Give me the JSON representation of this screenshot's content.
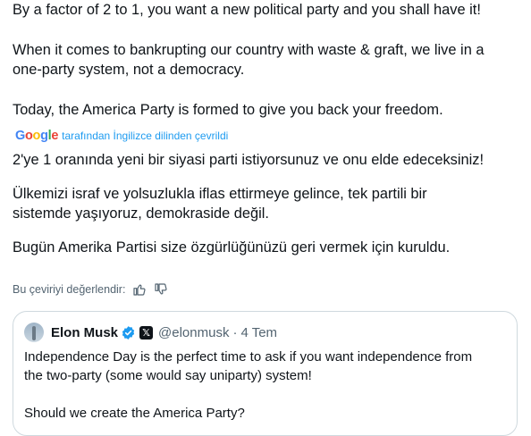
{
  "tweet": {
    "lines": [
      "By a factor of 2 to 1, you want a new political party and you shall have it!",
      "When it comes to bankrupting our country with waste & graft, we live in a",
      "one-party system, not a democracy.",
      "Today, the America Party is formed to give you back your freedom."
    ]
  },
  "translation": {
    "provider": "Google",
    "label": "tarafından İngilizce dilinden çevrildi",
    "lines": [
      "2'ye 1 oranında yeni bir siyasi parti istiyorsunuz ve onu elde edeceksiniz!",
      "Ülkemizi israf ve yolsuzlukla iflas ettirmeye gelince, tek partili bir",
      "sistemde yaşıyoruz, demokraside değil.",
      "Bugün Amerika Partisi size özgürlüğünüzü geri vermek için kuruldu."
    ],
    "rate_label": "Bu çeviriyi değerlendir:"
  },
  "quote": {
    "author_name": "Elon Musk",
    "handle": "@elonmusk",
    "separator": "·",
    "date": "4 Tem",
    "body": [
      "Independence Day is the perfect time to ask if you want independence from",
      "the two-party (some would say uniparty) system!",
      "Should we create the America Party?"
    ]
  },
  "colors": {
    "text": "#0f1419",
    "secondary": "#536471",
    "accent": "#1d9bf0",
    "border": "#cfd9de"
  },
  "icons": [
    "thumbs-up-icon",
    "thumbs-down-icon",
    "verified-badge-icon",
    "x-logo-icon"
  ]
}
